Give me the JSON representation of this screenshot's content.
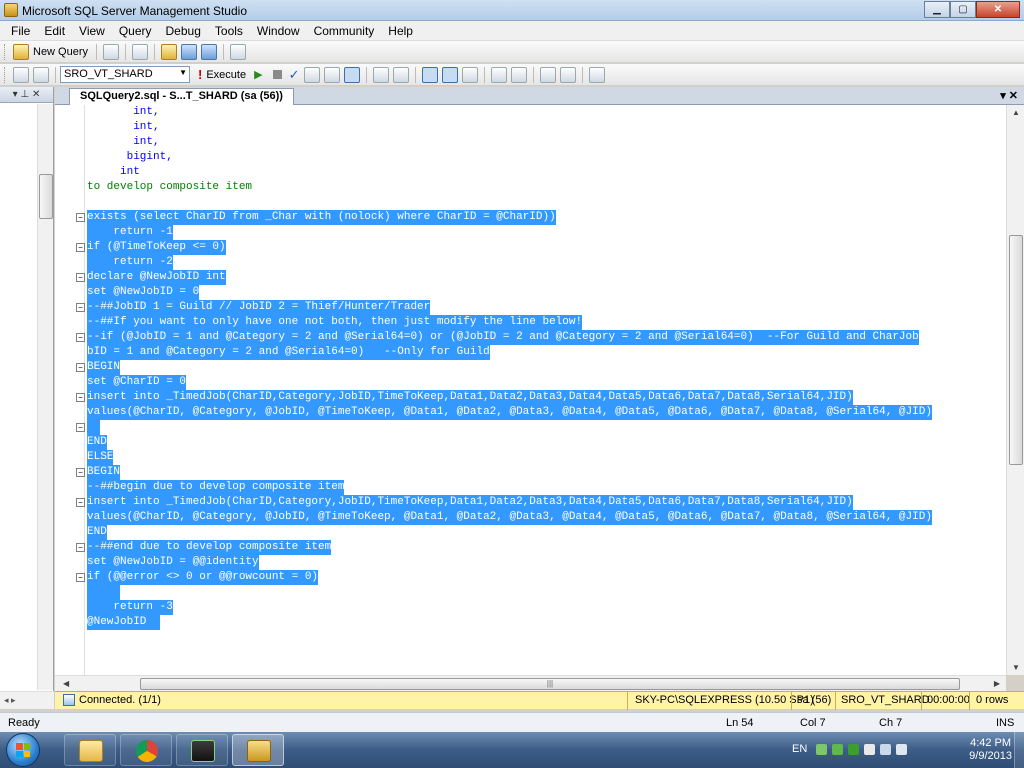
{
  "window": {
    "title": "Microsoft SQL Server Management Studio"
  },
  "menu": [
    "File",
    "Edit",
    "View",
    "Query",
    "Debug",
    "Tools",
    "Window",
    "Community",
    "Help"
  ],
  "toolbar": {
    "new_query": "New Query",
    "database": "SRO_VT_SHARD",
    "execute": "Execute"
  },
  "left_panel": {
    "pin": "▾ ⊥ ✕"
  },
  "document": {
    "tab_title": "SQLQuery2.sql - S...T_SHARD (sa (56))",
    "tab_controls": "▾ ✕"
  },
  "editor": {
    "lines": [
      {
        "text": "       int,",
        "style": "blue"
      },
      {
        "text": "       int,",
        "style": "blue"
      },
      {
        "text": "       int,",
        "style": "blue"
      },
      {
        "text": "      bigint,",
        "style": "blue"
      },
      {
        "text": "     int",
        "style": "blue"
      },
      {
        "text": "to develop composite item",
        "style": "green"
      },
      {
        "text": "",
        "style": "plain"
      },
      {
        "text": "exists (select CharID from _Char with (nolock) where CharID = @CharID))",
        "style": "sel"
      },
      {
        "text": "    return -1",
        "style": "sel"
      },
      {
        "text": "if (@TimeToKeep <= 0)",
        "style": "sel"
      },
      {
        "text": "    return -2",
        "style": "sel"
      },
      {
        "text": "declare @NewJobID int",
        "style": "sel"
      },
      {
        "text": "set @NewJobID = 0",
        "style": "sel"
      },
      {
        "text": "--##JobID 1 = Guild // JobID 2 = Thief/Hunter/Trader",
        "style": "sel"
      },
      {
        "text": "--##If you want to only have one not both, then just modify the line below!",
        "style": "sel"
      },
      {
        "text": "--if (@JobID = 1 and @Category = 2 and @Serial64=0) or (@JobID = 2 and @Category = 2 and @Serial64=0)  --For Guild and CharJob",
        "style": "sel"
      },
      {
        "text": "bID = 1 and @Category = 2 and @Serial64=0)   --Only for Guild",
        "style": "sel"
      },
      {
        "text": "BEGIN",
        "style": "sel"
      },
      {
        "text": "set @CharID = 0",
        "style": "sel"
      },
      {
        "text": "insert into _TimedJob(CharID,Category,JobID,TimeToKeep,Data1,Data2,Data3,Data4,Data5,Data6,Data7,Data8,Serial64,JID)",
        "style": "sel"
      },
      {
        "text": "values(@CharID, @Category, @JobID, @TimeToKeep, @Data1, @Data2, @Data3, @Data4, @Data5, @Data6, @Data7, @Data8, @Serial64, @JID)",
        "style": "sel"
      },
      {
        "text": "  ",
        "style": "sel"
      },
      {
        "text": "END",
        "style": "sel"
      },
      {
        "text": "ELSE",
        "style": "sel"
      },
      {
        "text": "BEGIN",
        "style": "sel"
      },
      {
        "text": "--##begin due to develop composite item",
        "style": "sel"
      },
      {
        "text": "insert into _TimedJob(CharID,Category,JobID,TimeToKeep,Data1,Data2,Data3,Data4,Data5,Data6,Data7,Data8,Serial64,JID)",
        "style": "sel"
      },
      {
        "text": "values(@CharID, @Category, @JobID, @TimeToKeep, @Data1, @Data2, @Data3, @Data4, @Data5, @Data6, @Data7, @Data8, @Serial64, @JID)",
        "style": "sel"
      },
      {
        "text": "END",
        "style": "sel"
      },
      {
        "text": "--##end due to develop composite item",
        "style": "sel"
      },
      {
        "text": "set @NewJobID = @@identity",
        "style": "sel"
      },
      {
        "text": "if (@@error <> 0 or @@rowcount = 0)",
        "style": "sel"
      },
      {
        "text": "     ",
        "style": "sel"
      },
      {
        "text": "    return -3",
        "style": "sel"
      },
      {
        "text": "@NewJobID  ",
        "style": "sel"
      }
    ]
  },
  "query_status": {
    "connected": "Connected. (1/1)",
    "server": "SKY-PC\\SQLEXPRESS (10.50 SP1)",
    "user": "sa (56)",
    "database": "SRO_VT_SHARD",
    "elapsed": "00:00:00",
    "rows": "0 rows"
  },
  "status": {
    "ready": "Ready",
    "ln": "Ln 54",
    "col": "Col 7",
    "ch": "Ch 7",
    "ins": "INS"
  },
  "taskbar": {
    "lang": "EN",
    "time": "4:42 PM",
    "date": "9/9/2013"
  },
  "colors": {
    "selection": "#3399ff",
    "keyword": "#0000ff",
    "comment": "#008000",
    "query_status_bg": "#fff3a8"
  }
}
